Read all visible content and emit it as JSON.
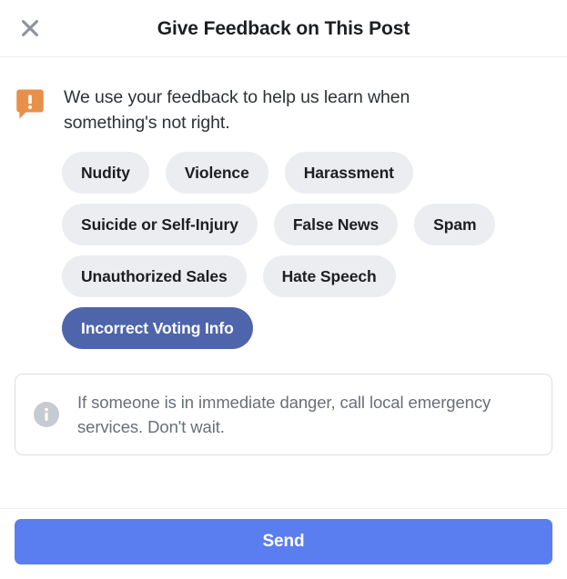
{
  "dialog": {
    "title": "Give Feedback on This Post",
    "close_icon": "close-icon"
  },
  "intro": {
    "icon": "feedback-bubble-icon",
    "text": "We use your feedback to help us learn when something's not right.",
    "icon_color": "#e8904a"
  },
  "options": {
    "selected": "Incorrect Voting Info",
    "chip_bg": "#ebedf0",
    "chip_selected_bg": "#4e65ac",
    "rows": [
      [
        {
          "label": "Nudity",
          "selected": false
        },
        {
          "label": "Violence",
          "selected": false
        },
        {
          "label": "Harassment",
          "selected": false
        }
      ],
      [
        {
          "label": "Suicide or Self-Injury",
          "selected": false
        },
        {
          "label": "False News",
          "selected": false
        },
        {
          "label": "Spam",
          "selected": false
        }
      ],
      [
        {
          "label": "Unauthorized Sales",
          "selected": false
        },
        {
          "label": "Hate Speech",
          "selected": false
        }
      ],
      [
        {
          "label": "Incorrect Voting Info",
          "selected": true
        }
      ]
    ]
  },
  "notice": {
    "icon": "info-icon",
    "text": "If someone is in immediate danger, call local emergency services. Don't wait.",
    "icon_color": "#c6cbd2"
  },
  "footer": {
    "send_label": "Send",
    "send_color": "#5a7df0"
  }
}
